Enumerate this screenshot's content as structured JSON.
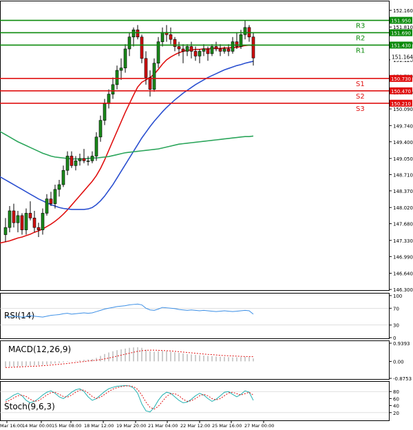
{
  "chart_data": {
    "type": "candlestick",
    "price": {
      "ylim": [
        146.3,
        152.16
      ],
      "y_ticks": [
        "152.160",
        "151.810",
        "151.470",
        "151.120",
        "150.780",
        "150.440",
        "150.090",
        "149.740",
        "149.400",
        "149.050",
        "148.710",
        "148.370",
        "148.020",
        "147.680",
        "147.330",
        "146.990",
        "146.640",
        "146.300"
      ],
      "current_price": "151.164",
      "levels": [
        {
          "label": "R3",
          "value": "151.950",
          "kind": "resistance",
          "color": "#0a8a0a"
        },
        {
          "label": "R2",
          "value": "151.690",
          "kind": "resistance",
          "color": "#0a8a0a"
        },
        {
          "label": "R1",
          "value": "151.430",
          "kind": "resistance",
          "color": "#0a8a0a"
        },
        {
          "label": "S1",
          "value": "150.730",
          "kind": "support",
          "color": "#e01010"
        },
        {
          "label": "S2",
          "value": "150.470",
          "kind": "support",
          "color": "#e01010"
        },
        {
          "label": "S3",
          "value": "150.210",
          "kind": "support",
          "color": "#e01010"
        }
      ],
      "candles": [
        [
          147.45,
          147.8,
          147.3,
          147.6
        ],
        [
          147.6,
          148.05,
          147.5,
          147.95
        ],
        [
          147.95,
          148.1,
          147.6,
          147.7
        ],
        [
          147.7,
          147.95,
          147.5,
          147.85
        ],
        [
          147.85,
          147.9,
          147.45,
          147.55
        ],
        [
          147.55,
          148.0,
          147.45,
          147.9
        ],
        [
          147.9,
          148.15,
          147.75,
          147.8
        ],
        [
          147.8,
          147.95,
          147.5,
          147.6
        ],
        [
          147.6,
          147.7,
          147.4,
          147.55
        ],
        [
          147.55,
          148.0,
          147.45,
          147.9
        ],
        [
          147.9,
          148.3,
          147.85,
          148.2
        ],
        [
          148.2,
          148.35,
          148.05,
          148.1
        ],
        [
          148.1,
          148.5,
          148.0,
          148.4
        ],
        [
          148.4,
          148.6,
          148.25,
          148.5
        ],
        [
          148.5,
          148.9,
          148.45,
          148.8
        ],
        [
          148.8,
          149.2,
          148.7,
          149.1
        ],
        [
          149.1,
          149.2,
          148.85,
          148.9
        ],
        [
          148.9,
          149.1,
          148.8,
          149.0
        ],
        [
          149.0,
          149.15,
          148.9,
          149.05
        ],
        [
          149.05,
          149.25,
          148.95,
          149.0
        ],
        [
          149.0,
          149.1,
          148.9,
          149.0
        ],
        [
          149.0,
          149.2,
          148.95,
          149.1
        ],
        [
          149.1,
          149.6,
          149.0,
          149.5
        ],
        [
          149.5,
          149.95,
          149.4,
          149.85
        ],
        [
          149.85,
          150.3,
          149.75,
          150.2
        ],
        [
          150.2,
          150.5,
          150.1,
          150.4
        ],
        [
          150.4,
          150.75,
          150.3,
          150.6
        ],
        [
          150.6,
          151.0,
          150.5,
          150.9
        ],
        [
          150.9,
          151.15,
          150.7,
          150.95
        ],
        [
          150.95,
          151.45,
          150.85,
          151.35
        ],
        [
          151.35,
          151.7,
          151.2,
          151.6
        ],
        [
          151.6,
          151.8,
          151.4,
          151.75
        ],
        [
          151.75,
          151.85,
          151.55,
          151.6
        ],
        [
          151.6,
          151.65,
          151.05,
          151.15
        ],
        [
          151.15,
          151.3,
          150.6,
          150.75
        ],
        [
          150.75,
          150.9,
          150.35,
          150.5
        ],
        [
          150.5,
          151.15,
          150.45,
          151.05
        ],
        [
          151.05,
          151.6,
          150.95,
          151.5
        ],
        [
          151.5,
          151.8,
          151.4,
          151.7
        ],
        [
          151.7,
          151.85,
          151.5,
          151.65
        ],
        [
          151.65,
          151.8,
          151.45,
          151.55
        ],
        [
          151.55,
          151.6,
          151.3,
          151.4
        ],
        [
          151.4,
          151.5,
          151.2,
          151.35
        ],
        [
          151.35,
          151.45,
          151.05,
          151.3
        ],
        [
          151.3,
          151.45,
          151.2,
          151.4
        ],
        [
          151.4,
          151.5,
          151.15,
          151.3
        ],
        [
          151.3,
          151.4,
          151.1,
          151.2
        ],
        [
          151.2,
          151.35,
          151.05,
          151.3
        ],
        [
          151.3,
          151.45,
          151.2,
          151.35
        ],
        [
          151.35,
          151.4,
          151.1,
          151.25
        ],
        [
          151.25,
          151.45,
          151.2,
          151.4
        ],
        [
          151.4,
          151.5,
          151.3,
          151.35
        ],
        [
          151.35,
          151.45,
          151.2,
          151.3
        ],
        [
          151.3,
          151.4,
          151.25,
          151.35
        ],
        [
          151.35,
          151.45,
          151.2,
          151.3
        ],
        [
          151.3,
          151.6,
          151.25,
          151.5
        ],
        [
          151.5,
          151.7,
          151.35,
          151.4
        ],
        [
          151.4,
          151.75,
          151.35,
          151.65
        ],
        [
          151.65,
          151.95,
          151.55,
          151.8
        ],
        [
          151.8,
          151.85,
          151.5,
          151.6
        ],
        [
          151.6,
          151.7,
          151.0,
          151.16
        ]
      ],
      "moving_averages": [
        {
          "color": "#e01010",
          "values": [
            147.3,
            147.32,
            147.35,
            147.38,
            147.4,
            147.43,
            147.46,
            147.5,
            147.53,
            147.57,
            147.62,
            147.67,
            147.73,
            147.8,
            147.88,
            147.97,
            148.07,
            148.17,
            148.27,
            148.37,
            148.47,
            148.57,
            148.69,
            148.84,
            149.02,
            149.22,
            149.42,
            149.62,
            149.82,
            150.02,
            150.2,
            150.38,
            150.55,
            150.65,
            150.7,
            150.75,
            150.82,
            150.92,
            151.03,
            151.12,
            151.18,
            151.23,
            151.27,
            151.3,
            151.32,
            151.33,
            151.34,
            151.34,
            151.35,
            151.35,
            151.36,
            151.36,
            151.36,
            151.37,
            151.37,
            151.38,
            151.38,
            151.4,
            151.42,
            151.43,
            151.42
          ]
        },
        {
          "color": "#2a4fd0",
          "values": [
            148.6,
            148.55,
            148.5,
            148.45,
            148.4,
            148.35,
            148.3,
            148.25,
            148.2,
            148.16,
            148.12,
            148.08,
            148.05,
            148.02,
            148.0,
            147.99,
            147.98,
            147.98,
            147.98,
            147.98,
            147.99,
            148.02,
            148.08,
            148.16,
            148.26,
            148.38,
            148.5,
            148.64,
            148.78,
            148.92,
            149.06,
            149.2,
            149.34,
            149.48,
            149.6,
            149.72,
            149.83,
            149.93,
            150.03,
            150.12,
            150.2,
            150.28,
            150.35,
            150.42,
            150.48,
            150.54,
            150.6,
            150.65,
            150.7,
            150.75,
            150.79,
            150.83,
            150.87,
            150.91,
            150.94,
            150.97,
            151.0,
            151.02,
            151.05,
            151.07,
            151.09
          ]
        },
        {
          "color": "#2aa55a",
          "values": [
            149.55,
            149.5,
            149.45,
            149.4,
            149.36,
            149.32,
            149.28,
            149.24,
            149.2,
            149.16,
            149.13,
            149.1,
            149.08,
            149.07,
            149.06,
            149.05,
            149.04,
            149.04,
            149.04,
            149.04,
            149.05,
            149.06,
            149.06,
            149.07,
            149.08,
            149.09,
            149.11,
            149.13,
            149.15,
            149.17,
            149.18,
            149.19,
            149.2,
            149.21,
            149.22,
            149.23,
            149.24,
            149.25,
            149.27,
            149.29,
            149.31,
            149.33,
            149.35,
            149.36,
            149.37,
            149.38,
            149.39,
            149.4,
            149.41,
            149.42,
            149.43,
            149.44,
            149.45,
            149.46,
            149.47,
            149.48,
            149.49,
            149.5,
            149.51,
            149.51,
            149.52
          ]
        }
      ]
    },
    "rsi": {
      "label": "RSI(14)",
      "y_ticks": [
        "100",
        "70",
        "30",
        "0"
      ],
      "ylim": [
        0,
        100
      ],
      "values": [
        50,
        50,
        51,
        50,
        49,
        50,
        52,
        51,
        50,
        49,
        51,
        53,
        54,
        55,
        57,
        58,
        56,
        57,
        58,
        59,
        58,
        59,
        62,
        65,
        68,
        70,
        72,
        74,
        75,
        76,
        78,
        79,
        80,
        78,
        70,
        66,
        65,
        68,
        72,
        71,
        70,
        69,
        67,
        66,
        65,
        66,
        65,
        64,
        65,
        64,
        63,
        62,
        63,
        64,
        63,
        62,
        63,
        64,
        65,
        64,
        56
      ]
    },
    "macd": {
      "label": "MACD(12,26,9)",
      "y_ticks": [
        "0.9393",
        "0.00",
        "-0.8753"
      ],
      "ylim": [
        -0.8753,
        0.9393
      ],
      "histogram": [
        -0.3,
        -0.28,
        -0.27,
        -0.26,
        -0.25,
        -0.24,
        -0.22,
        -0.21,
        -0.2,
        -0.18,
        -0.16,
        -0.13,
        -0.1,
        -0.08,
        -0.05,
        -0.02,
        0.01,
        0.03,
        0.06,
        0.08,
        0.1,
        0.12,
        0.18,
        0.28,
        0.38,
        0.46,
        0.52,
        0.58,
        0.62,
        0.66,
        0.7,
        0.72,
        0.73,
        0.7,
        0.6,
        0.52,
        0.5,
        0.52,
        0.54,
        0.53,
        0.5,
        0.47,
        0.44,
        0.41,
        0.38,
        0.36,
        0.34,
        0.32,
        0.3,
        0.28,
        0.27,
        0.25,
        0.24,
        0.23,
        0.22,
        0.21,
        0.21,
        0.22,
        0.23,
        0.22,
        0.15
      ],
      "signal": [
        -0.32,
        -0.31,
        -0.3,
        -0.29,
        -0.28,
        -0.27,
        -0.26,
        -0.25,
        -0.24,
        -0.22,
        -0.21,
        -0.19,
        -0.17,
        -0.15,
        -0.13,
        -0.11,
        -0.08,
        -0.06,
        -0.03,
        -0.01,
        0.02,
        0.04,
        0.06,
        0.09,
        0.13,
        0.17,
        0.22,
        0.27,
        0.32,
        0.37,
        0.42,
        0.47,
        0.52,
        0.55,
        0.57,
        0.58,
        0.58,
        0.57,
        0.56,
        0.55,
        0.54,
        0.52,
        0.5,
        0.48,
        0.46,
        0.44,
        0.42,
        0.4,
        0.38,
        0.36,
        0.35,
        0.33,
        0.31,
        0.3,
        0.29,
        0.28,
        0.27,
        0.26,
        0.25,
        0.25,
        0.24
      ]
    },
    "stoch": {
      "label": "Stoch(9,6,3)",
      "y_ticks": [
        "80",
        "60",
        "40",
        "20"
      ],
      "ylim": [
        0,
        100
      ],
      "k": [
        55,
        62,
        70,
        75,
        68,
        55,
        48,
        52,
        60,
        70,
        78,
        82,
        75,
        65,
        60,
        68,
        78,
        85,
        88,
        80,
        65,
        55,
        60,
        70,
        80,
        88,
        92,
        95,
        96,
        97,
        96,
        90,
        75,
        45,
        25,
        22,
        35,
        55,
        70,
        78,
        75,
        65,
        55,
        48,
        50,
        58,
        68,
        75,
        70,
        60,
        52,
        58,
        68,
        78,
        80,
        72,
        65,
        72,
        82,
        78,
        55
      ],
      "d": [
        50,
        55,
        62,
        68,
        70,
        66,
        58,
        52,
        54,
        62,
        70,
        77,
        78,
        72,
        66,
        64,
        70,
        78,
        84,
        84,
        76,
        66,
        60,
        64,
        72,
        80,
        87,
        91,
        94,
        96,
        96,
        94,
        86,
        70,
        50,
        35,
        30,
        38,
        52,
        66,
        74,
        74,
        68,
        58,
        52,
        54,
        60,
        68,
        72,
        68,
        60,
        56,
        60,
        68,
        76,
        78,
        74,
        70,
        74,
        78,
        70
      ]
    },
    "x_ticks": [
      "Mar 16:00",
      "14 Mar 00:00",
      "15 Mar 08:00",
      "18 Mar 12:00",
      "19 Mar 20:00",
      "21 Mar 04:00",
      "22 Mar 12:00",
      "25 Mar 16:00",
      "27 Mar 00:00"
    ]
  }
}
